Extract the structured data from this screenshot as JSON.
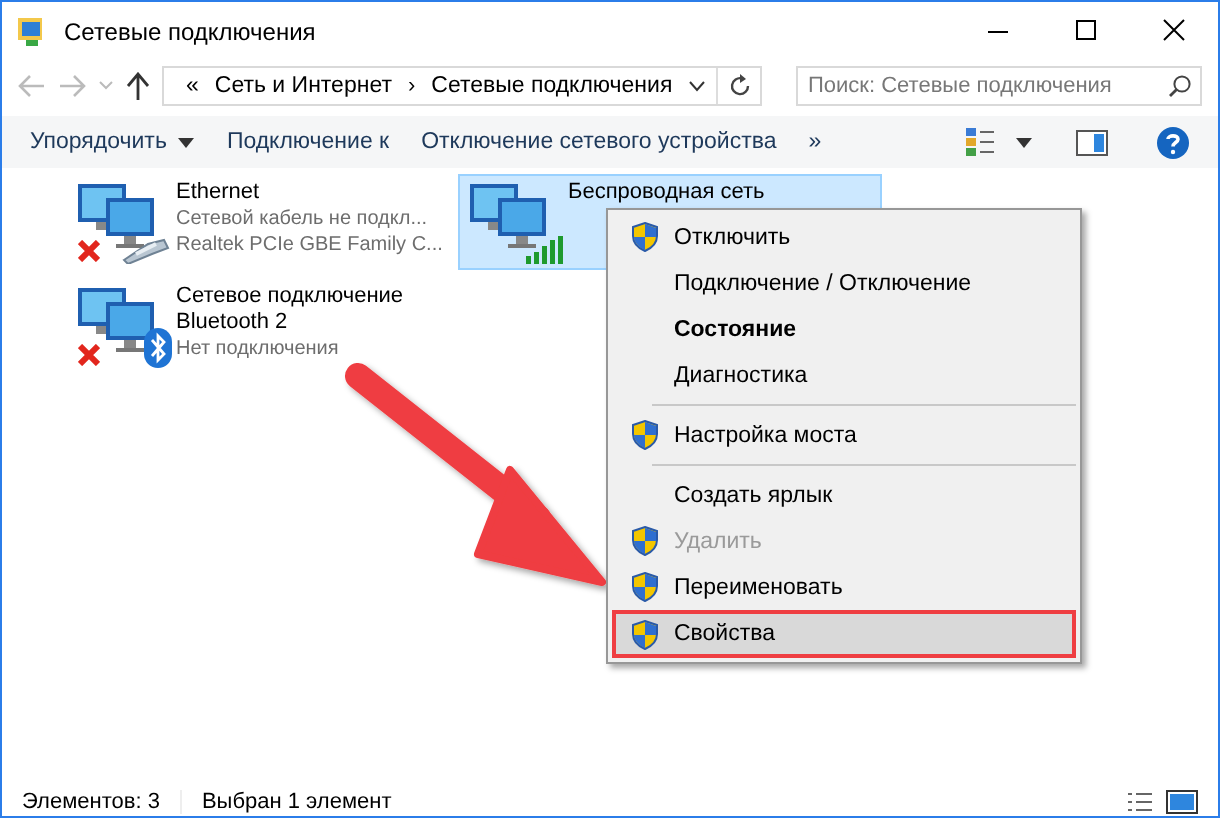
{
  "window": {
    "title": "Сетевые подключения"
  },
  "address": {
    "overflow": "«",
    "separator": "›",
    "crumbs": [
      "Сеть и Интернет",
      "Сетевые подключения"
    ]
  },
  "search": {
    "placeholder": "Поиск: Сетевые подключения"
  },
  "toolbar": [
    {
      "label": "Упорядочить",
      "dropdown": true
    },
    {
      "label": "Подключение к",
      "dropdown": false
    },
    {
      "label": "Отключение сетевого устройства",
      "dropdown": false
    },
    {
      "label": "»",
      "dropdown": false
    }
  ],
  "connections": [
    {
      "kind": "ethernet",
      "name": "Ethernet",
      "lines": [
        "Сетевой кабель не подкл...",
        "Realtek PCIe GBE Family C..."
      ],
      "disconnected": true,
      "selected": false
    },
    {
      "kind": "wireless",
      "name": "Беспроводная сеть",
      "disconnected": false,
      "selected": true
    },
    {
      "kind": "bluetooth",
      "name": "Сетевое подключение Bluetooth 2",
      "lines": [
        "Нет подключения"
      ],
      "disconnected": true,
      "selected": false
    }
  ],
  "context_menu": [
    {
      "kind": "item",
      "label": "Отключить",
      "shield": true,
      "bold": false,
      "disabled": false,
      "selected": false
    },
    {
      "kind": "item",
      "label": "Подключение / Отключение",
      "shield": false,
      "bold": false,
      "disabled": false,
      "selected": false
    },
    {
      "kind": "item",
      "label": "Состояние",
      "shield": false,
      "bold": true,
      "disabled": false,
      "selected": false
    },
    {
      "kind": "item",
      "label": "Диагностика",
      "shield": false,
      "bold": false,
      "disabled": false,
      "selected": false
    },
    {
      "kind": "separator"
    },
    {
      "kind": "item",
      "label": "Настройка моста",
      "shield": true,
      "bold": false,
      "disabled": false,
      "selected": false
    },
    {
      "kind": "separator"
    },
    {
      "kind": "item",
      "label": "Создать ярлык",
      "shield": false,
      "bold": false,
      "disabled": false,
      "selected": false
    },
    {
      "kind": "item",
      "label": "Удалить",
      "shield": true,
      "bold": false,
      "disabled": true,
      "selected": false
    },
    {
      "kind": "item",
      "label": "Переименовать",
      "shield": true,
      "bold": false,
      "disabled": false,
      "selected": false
    },
    {
      "kind": "item",
      "label": "Свойства",
      "shield": true,
      "bold": false,
      "disabled": false,
      "selected": true
    }
  ],
  "status_bar": [
    "Элементов: 3",
    "Выбран 1 элемент"
  ]
}
